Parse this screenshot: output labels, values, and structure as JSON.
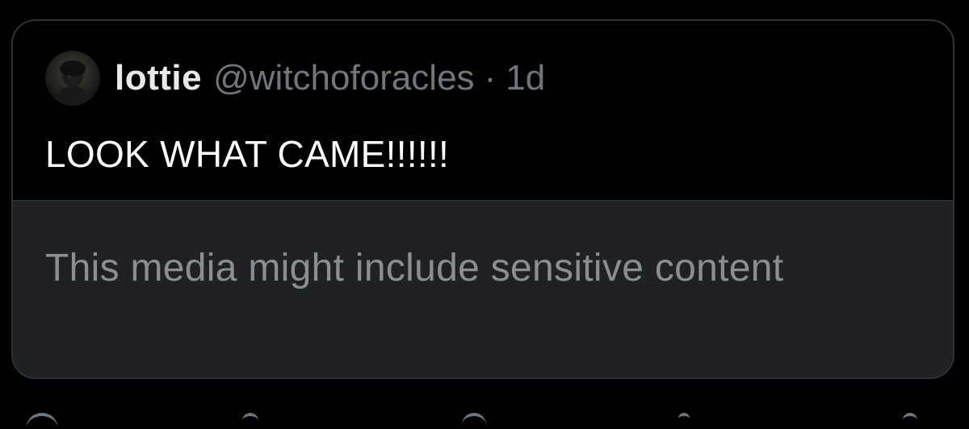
{
  "quoted_tweet": {
    "display_name": "lottie",
    "handle": "@witchoforacles",
    "separator": "·",
    "time": "1d",
    "text": "LOOK WHAT CAME!!!!!!",
    "media_warning": "This media might include sensitive content"
  },
  "action_bar": {
    "icons": [
      "reply-icon",
      "retweet-icon",
      "like-icon",
      "views-icon",
      "share-icon"
    ]
  },
  "colors": {
    "background": "#000000",
    "card_border": "#2f3336",
    "media_panel": "#202124",
    "primary_text": "#e7e9ea",
    "secondary_text": "#71767b",
    "warning_text": "#8b8f93"
  }
}
